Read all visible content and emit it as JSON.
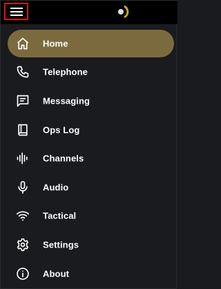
{
  "colors": {
    "topbar_bg": "#000000",
    "drawer_bg": "#1a1b1e",
    "active_pill": "#7c6a3f",
    "logo_accent": "#c9a227",
    "highlight_border": "#d8131d"
  },
  "header": {
    "menu_icon": "hamburger-menu-icon",
    "logo_icon": "brand-logo-icon"
  },
  "nav": {
    "items": [
      {
        "label": "Home",
        "icon": "home-icon",
        "active": true
      },
      {
        "label": "Telephone",
        "icon": "phone-icon",
        "active": false
      },
      {
        "label": "Messaging",
        "icon": "message-icon",
        "active": false
      },
      {
        "label": "Ops Log",
        "icon": "book-icon",
        "active": false
      },
      {
        "label": "Channels",
        "icon": "audio-waveform-icon",
        "active": false
      },
      {
        "label": "Audio",
        "icon": "microphone-icon",
        "active": false
      },
      {
        "label": "Tactical",
        "icon": "wifi-icon",
        "active": false
      },
      {
        "label": "Settings",
        "icon": "gear-icon",
        "active": false
      },
      {
        "label": "About",
        "icon": "info-icon",
        "active": false
      }
    ]
  }
}
